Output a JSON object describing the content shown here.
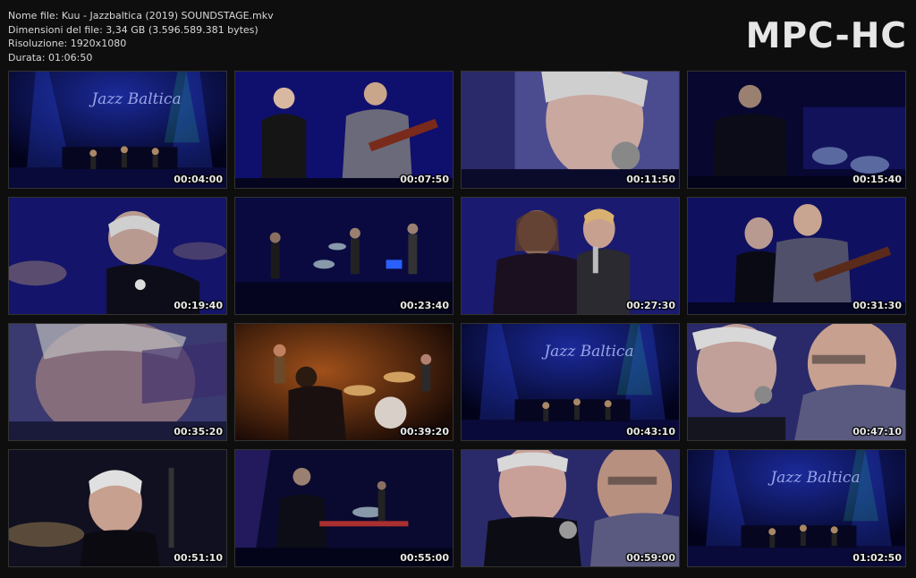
{
  "file_info": {
    "name_line": "Nome file: Kuu - Jazzbaltica (2019) SOUNDSTAGE.mkv",
    "size_line": "Dimensioni del file: 3,34 GB (3.596.589.381 bytes)",
    "resolution_line": "Risoluzione: 1920x1080",
    "duration_line": "Durata: 01:06:50"
  },
  "logo": "MPC-HC",
  "thumbnails": [
    {
      "time": "00:04:00",
      "scene": "stage-wide",
      "banner": "Jazz Baltica"
    },
    {
      "time": "00:07:50",
      "scene": "duo-guitar"
    },
    {
      "time": "00:11:50",
      "scene": "singer-closeup"
    },
    {
      "time": "00:15:40",
      "scene": "band-back"
    },
    {
      "time": "00:19:40",
      "scene": "singer-profile"
    },
    {
      "time": "00:23:40",
      "scene": "band-dark"
    },
    {
      "time": "00:27:30",
      "scene": "duo-singing"
    },
    {
      "time": "00:31:30",
      "scene": "duo-guitar-dark"
    },
    {
      "time": "00:35:20",
      "scene": "overlay-closeup"
    },
    {
      "time": "00:39:20",
      "scene": "orange-drums"
    },
    {
      "time": "00:43:10",
      "scene": "stage-wide",
      "banner": "Jazz Baltica"
    },
    {
      "time": "00:47:10",
      "scene": "duo-closeup"
    },
    {
      "time": "00:51:10",
      "scene": "singer-smile"
    },
    {
      "time": "00:55:00",
      "scene": "band-red"
    },
    {
      "time": "00:59:00",
      "scene": "duo-closeup-2"
    },
    {
      "time": "01:02:50",
      "scene": "stage-wide",
      "banner": "Jazz Baltica"
    }
  ]
}
